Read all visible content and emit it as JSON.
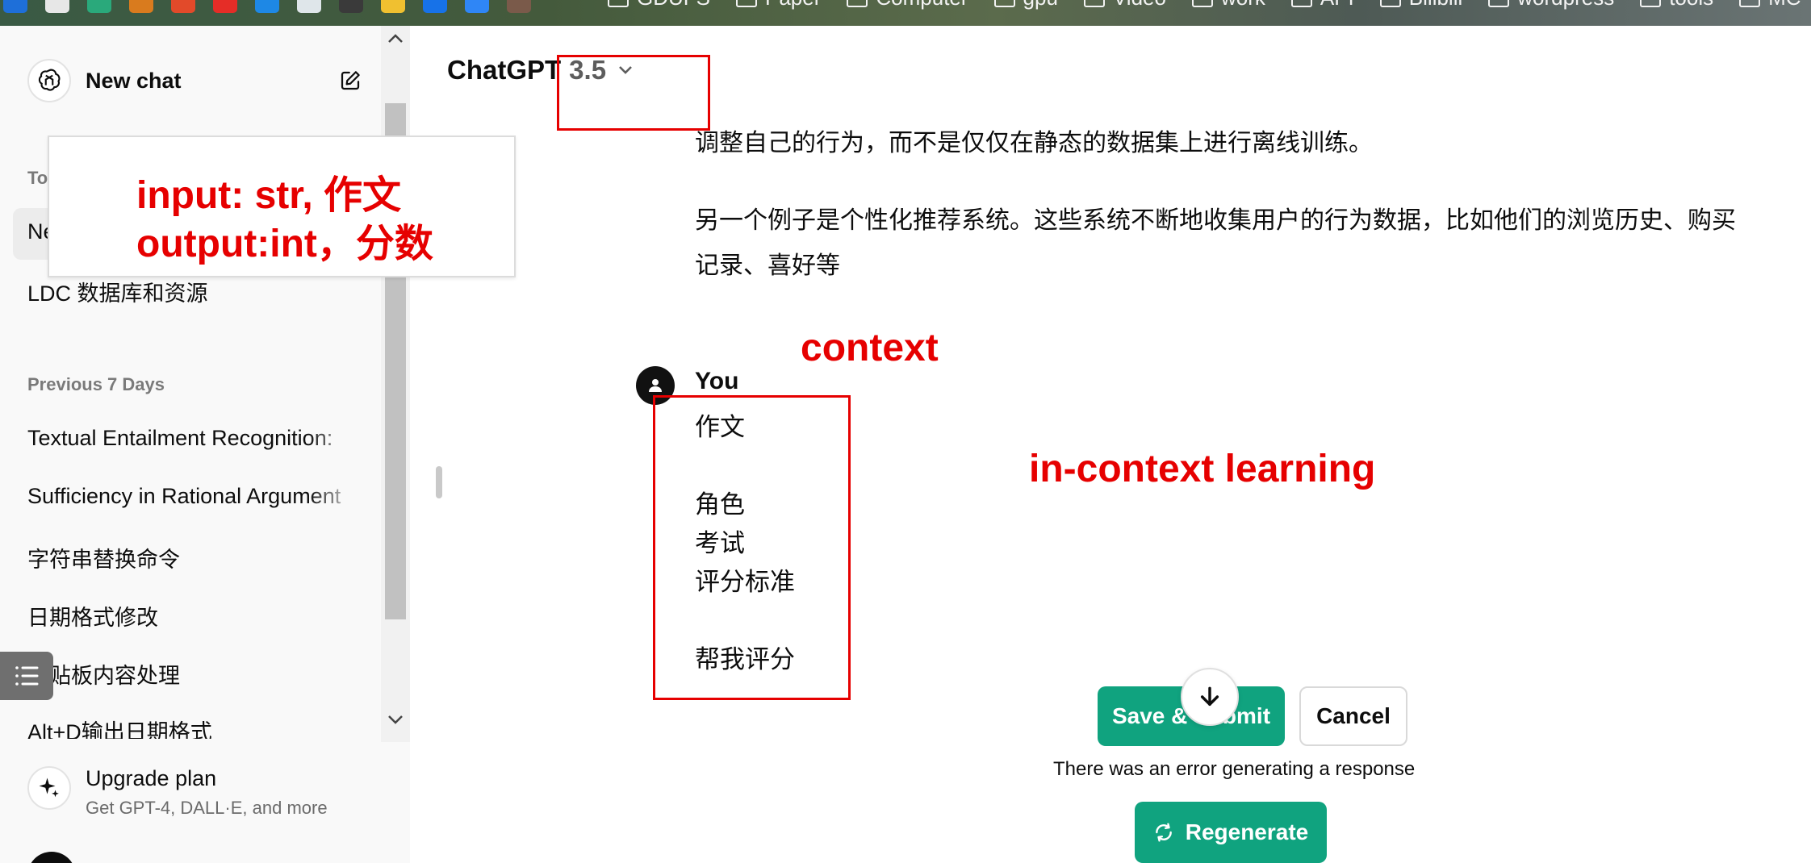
{
  "bookmarks": {
    "folders": [
      "GDUFS",
      "Paper",
      "Computer",
      "gpu",
      "Video",
      "work",
      "API",
      "Bilibili",
      "wordpress",
      "tools",
      "MC"
    ]
  },
  "sidebar": {
    "new_chat": "New chat",
    "today_label": "To",
    "today_items": [
      {
        "label": "Ne"
      },
      {
        "label": "LDC 数据库和资源"
      }
    ],
    "previous_label": "Previous 7 Days",
    "previous_items": [
      {
        "label": "Textual Entailment Recognition:"
      },
      {
        "label": "Sufficiency in Rational Argument"
      },
      {
        "label": "字符串替换命令"
      },
      {
        "label": "日期格式修改"
      },
      {
        "label": "剪贴板内容处理"
      },
      {
        "label": "Alt+D输出日期格式"
      }
    ],
    "upgrade": {
      "title": "Upgrade plan",
      "subtitle": "Get GPT-4, DALL·E, and more"
    }
  },
  "header": {
    "model_name": "ChatGPT",
    "model_version": "3.5"
  },
  "conversation": {
    "assistant_lines": [
      "调整自己的行为，而不是仅仅在静态的数据集上进行离线训练。",
      "另一个例子是个性化推荐系统。这些系统不断地收集用户的行为数据，比如他们的浏览历史、购买",
      "记录、喜好等"
    ],
    "user_name": "You",
    "user_lines": [
      "作文",
      "角色",
      "考试",
      "评分标准",
      "帮我评分"
    ]
  },
  "actions": {
    "save_submit": "Save & Submit",
    "cancel": "Cancel",
    "error": "There was an error generating a response",
    "regenerate": "Regenerate"
  },
  "annotations": {
    "io_line1": "input: str, 作文",
    "io_line2": "output:int，分数",
    "context": "context",
    "icl": "in-context learning"
  },
  "colors": {
    "accent_green": "#10a37f",
    "annotation_red": "#e60000"
  }
}
